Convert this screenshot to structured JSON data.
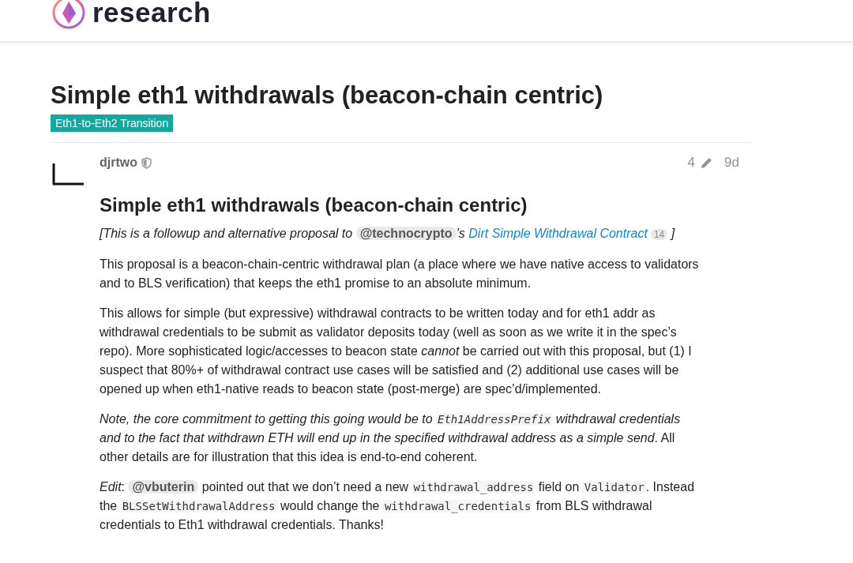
{
  "header": {
    "logo_text": "research"
  },
  "topic": {
    "title": "Simple eth1 withdrawals (beacon-chain centric)",
    "category": "Eth1-to-Eth2 Transition"
  },
  "post": {
    "username": "djrtwo",
    "edits": "4",
    "age": "9d",
    "heading": "Simple eth1 withdrawals (beacon-chain centric)",
    "paragraphs": [
      {
        "italic": true,
        "segments": [
          {
            "kind": "text",
            "text": "[This is a followup and alternative proposal to "
          },
          {
            "kind": "mention",
            "text": "@technocrypto"
          },
          {
            "kind": "text",
            "text": "’s "
          },
          {
            "kind": "link",
            "text": "Dirt Simple Withdrawal Contract",
            "count": "14"
          },
          {
            "kind": "text",
            "text": " ]"
          }
        ]
      },
      {
        "italic": false,
        "segments": [
          {
            "kind": "text",
            "text": "This proposal is a beacon-chain-centric withdrawal plan (a place where we have native access to validators and to BLS verification) that keeps the eth1 promise to an absolute minimum."
          }
        ]
      },
      {
        "italic": false,
        "segments": [
          {
            "kind": "text",
            "text": "This allows for simple (but expressive) withdrawal contracts to be written today and for eth1 addr as withdrawal credentials to be submit as validator deposits today (well as soon as we write it in the spec’s repo). More sophisticated logic/accesses to beacon state "
          },
          {
            "kind": "em",
            "text": "cannot"
          },
          {
            "kind": "text",
            "text": " be carried out with this proposal, but (1) I suspect that 80%+ of withdrawal contract use cases will be satisfied and (2) additional use cases will be opened up when eth1-native reads to beacon state (post-merge) are spec’d/implemented."
          }
        ]
      },
      {
        "italic": false,
        "segments": [
          {
            "kind": "em",
            "text": "Note, the core commitment to getting this going would be to "
          },
          {
            "kind": "emcode",
            "text": "Eth1AddressPrefix"
          },
          {
            "kind": "em",
            "text": " withdrawal credentials and to the fact that withdrawn ETH will end up in the specified withdrawal address as a simple send"
          },
          {
            "kind": "text",
            "text": ". All other details are for illustration that this idea is end-to-end coherent."
          }
        ]
      },
      {
        "italic": false,
        "segments": [
          {
            "kind": "em",
            "text": "Edit"
          },
          {
            "kind": "text",
            "text": ": "
          },
          {
            "kind": "mention",
            "text": "@vbuterin"
          },
          {
            "kind": "text",
            "text": " pointed out that we don’t need a new "
          },
          {
            "kind": "code",
            "text": "withdrawal_address"
          },
          {
            "kind": "text",
            "text": " field on "
          },
          {
            "kind": "code",
            "text": "Validator"
          },
          {
            "kind": "text",
            "text": ". Instead the "
          },
          {
            "kind": "code",
            "text": "BLSSetWithdrawalAddress"
          },
          {
            "kind": "text",
            "text": " would change the "
          },
          {
            "kind": "code",
            "text": "withdrawal_credentials"
          },
          {
            "kind": "text",
            "text": " from BLS withdrawal credentials to Eth1 withdrawal credentials. Thanks!"
          }
        ]
      }
    ]
  }
}
